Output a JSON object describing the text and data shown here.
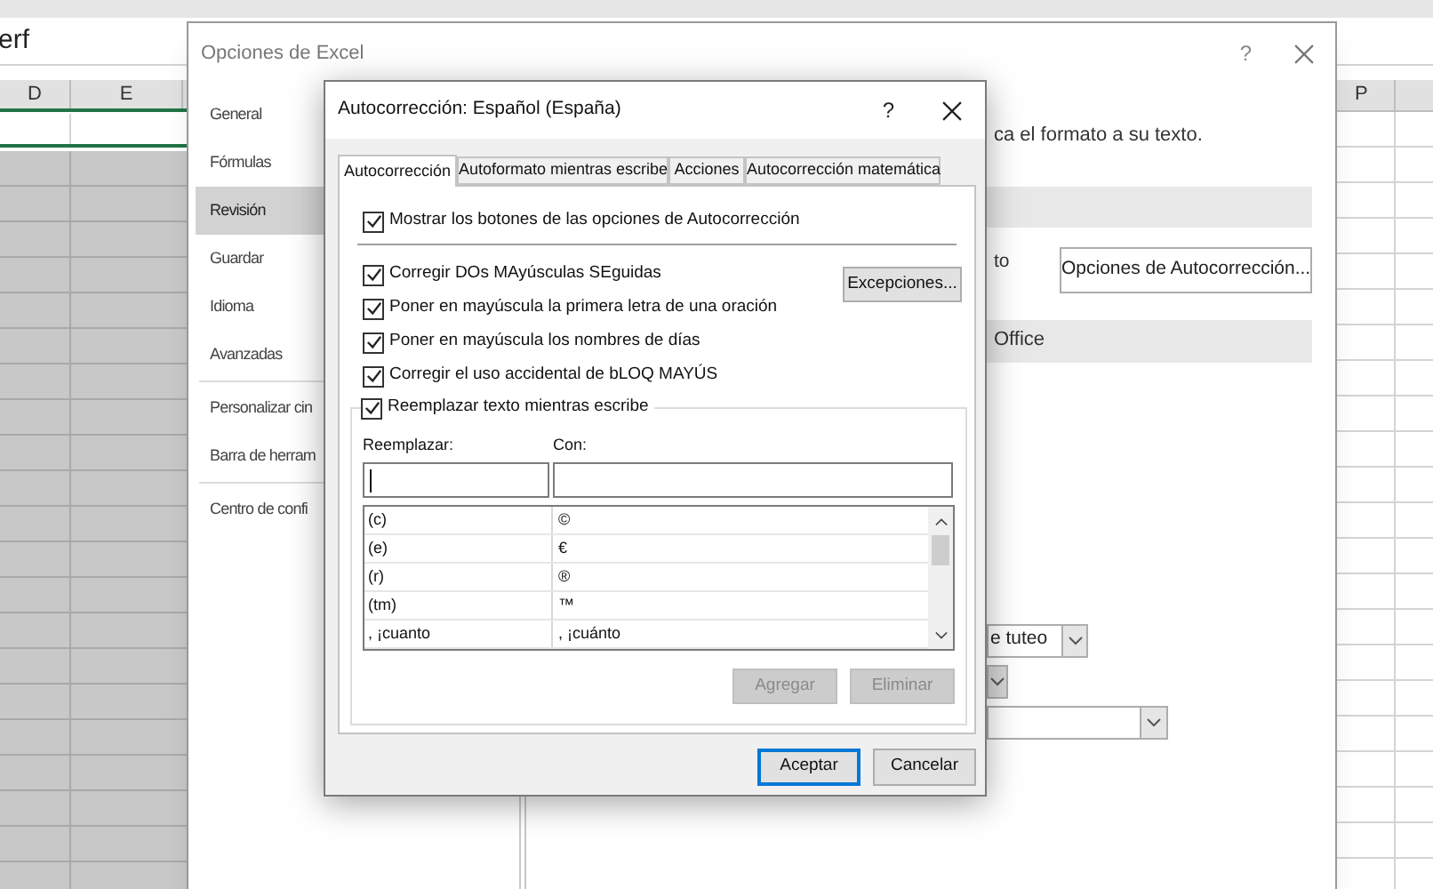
{
  "spreadsheet": {
    "formula_bar_text": "erf",
    "columns_left": [
      "D",
      "E"
    ],
    "columns_right": [
      "P"
    ]
  },
  "options_window": {
    "title": "Opciones de Excel",
    "help": "?",
    "sidebar_groups": [
      {
        "items": [
          {
            "label": "General",
            "selected": false
          },
          {
            "label": "Fórmulas",
            "selected": false
          },
          {
            "label": "Revisión",
            "selected": true
          },
          {
            "label": "Guardar",
            "selected": false
          },
          {
            "label": "Idioma",
            "selected": false
          },
          {
            "label": "Avanzadas",
            "selected": false
          }
        ]
      },
      {
        "items": [
          {
            "label": "Personalizar cin",
            "selected": false
          },
          {
            "label": "Barra de herram",
            "selected": false
          }
        ]
      },
      {
        "items": [
          {
            "label": "Centro de confi",
            "selected": false
          }
        ]
      }
    ],
    "intro_text": "ca el formato a su texto.",
    "autocorrect_label": "to",
    "autocorrect_options_button": "Opciones de Autocorrección...",
    "section_header": "Office",
    "dropdown_value": "e tuteo"
  },
  "dialog": {
    "title": "Autocorrección: Español (España)",
    "help": "?",
    "tabs": [
      {
        "label": "Autocorrección",
        "selected": true
      },
      {
        "label": "Autoformato mientras escribe",
        "selected": false
      },
      {
        "label": "Acciones",
        "selected": false
      },
      {
        "label": "Autocorrección matemática",
        "selected": false
      }
    ],
    "show_buttons_option": {
      "label": "Mostrar los botones de las opciones de Autocorrección",
      "checked": true
    },
    "options": [
      {
        "label": "Corregir DOs MAyúsculas SEguidas",
        "checked": true
      },
      {
        "label": "Poner en mayúscula la primera letra de una oración",
        "checked": true
      },
      {
        "label": "Poner en mayúscula los nombres de días",
        "checked": true
      },
      {
        "label": "Corregir el uso accidental de bLOQ MAYÚS",
        "checked": true
      }
    ],
    "exceptions_button": "Excepciones...",
    "replace_option": {
      "label": "Reemplazar texto mientras escribe",
      "checked": true
    },
    "replace_label": "Reemplazar:",
    "with_label": "Con:",
    "rows": [
      {
        "replace": "(c)",
        "with": "©"
      },
      {
        "replace": "(e)",
        "with": "€"
      },
      {
        "replace": "(r)",
        "with": "®"
      },
      {
        "replace": "(tm)",
        "with": "™"
      },
      {
        "replace": ", ¡cuanto",
        "with": ", ¡cuánto"
      }
    ],
    "list_buttons": [
      {
        "label": "Agregar",
        "disabled": true
      },
      {
        "label": "Eliminar",
        "disabled": true
      }
    ],
    "footer_buttons": [
      {
        "label": "Aceptar",
        "default": true
      },
      {
        "label": "Cancelar",
        "default": false
      }
    ]
  }
}
